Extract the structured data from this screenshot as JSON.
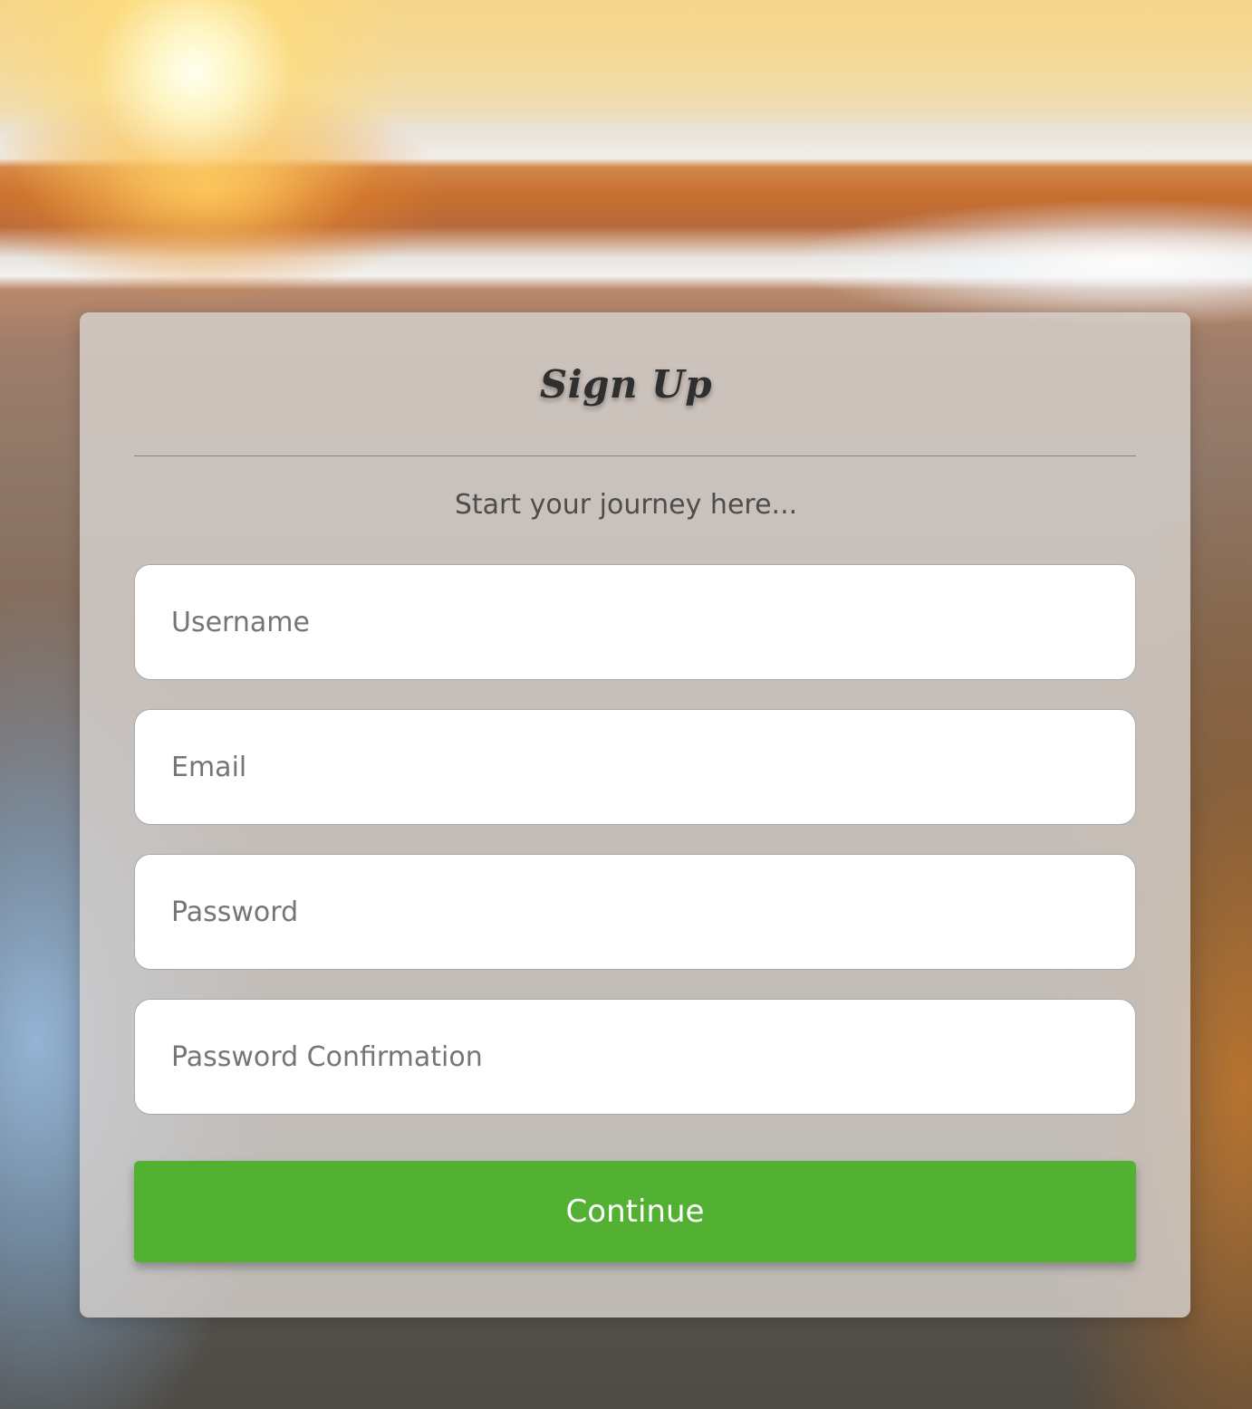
{
  "form": {
    "title": "Sign Up",
    "subtitle": "Start your journey here...",
    "fields": [
      {
        "placeholder": "Username",
        "value": ""
      },
      {
        "placeholder": "Email",
        "value": ""
      },
      {
        "placeholder": "Password",
        "value": ""
      },
      {
        "placeholder": "Password Confirmation",
        "value": ""
      }
    ],
    "submit_label": "Continue"
  },
  "colors": {
    "accent": "#52b133",
    "card_background": "#d7d2ce",
    "title_text": "#2f2f2f"
  }
}
